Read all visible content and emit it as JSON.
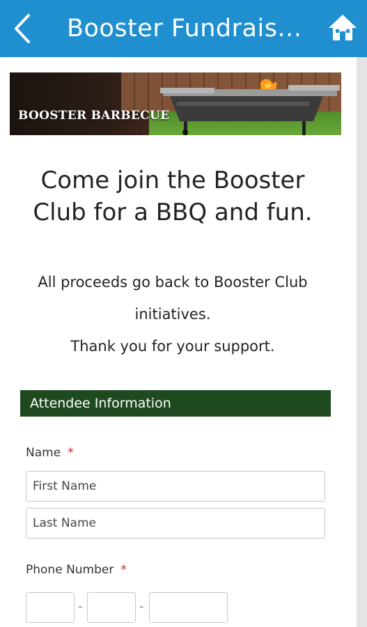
{
  "app_bar": {
    "title": "Booster Fundrais...",
    "back_icon": "chevron-left-icon",
    "home_icon": "home-icon",
    "color": "#1f8fd0"
  },
  "banner": {
    "text": "BOOSTER BARBECUE"
  },
  "headline": "Come join the Booster Club for a BBQ and fun.",
  "body": {
    "line1": "All proceeds go back to Booster Club",
    "line2": "initiatives.",
    "line3": "Thank you for your support."
  },
  "section": {
    "title": "Attendee Information",
    "color": "#1f4a1f"
  },
  "form": {
    "name_label": "Name",
    "required_mark": "*",
    "first_name_placeholder": "First Name",
    "last_name_placeholder": "Last Name",
    "phone_label": "Phone Number",
    "phone_separator": "-",
    "required_color": "#d0201f"
  }
}
